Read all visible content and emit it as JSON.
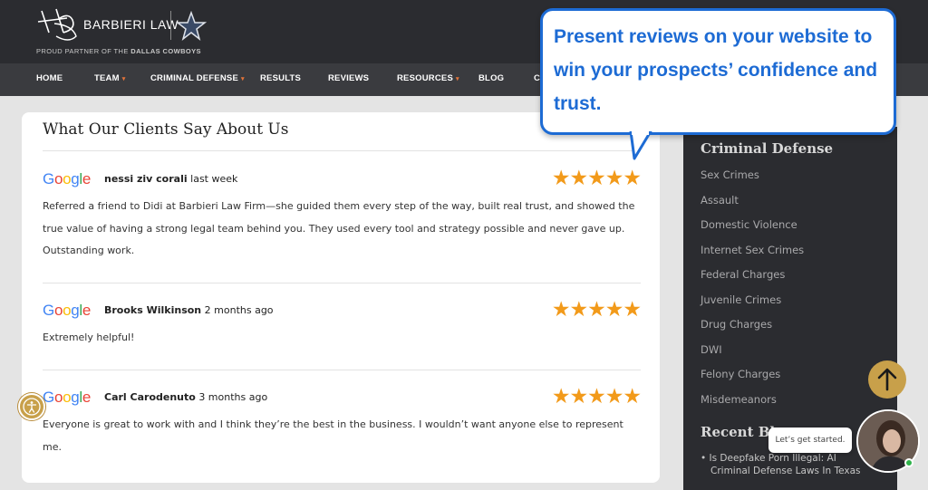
{
  "header": {
    "brand_name": "BARBIERI LAW",
    "partner_text_prefix": "PROUD PARTNER OF THE ",
    "partner_text_strong": "DALLAS COWBOYS"
  },
  "nav": {
    "home": "HOME",
    "team": "TEAM",
    "criminal_defense": "CRIMINAL DEFENSE",
    "results": "RESULTS",
    "reviews": "REVIEWS",
    "resources": "RESOURCES",
    "blog": "BLOG",
    "contact_partial": "C",
    "dropdown_caret": "▾"
  },
  "reviews_card": {
    "title": "What Our Clients Say About Us",
    "stars": "★★★★★",
    "google_letters": [
      "G",
      "o",
      "o",
      "g",
      "l",
      "e"
    ],
    "items": [
      {
        "name": "nessi ziv corali",
        "time": "last week",
        "rating": 5,
        "text": "Referred a friend to Didi at Barbieri Law Firm—she guided them every step of the way, built real trust, and showed the true value of having a strong legal team behind you. They used every tool and strategy possible and never gave up. Outstanding work."
      },
      {
        "name": "Brooks Wilkinson",
        "time": "2 months ago",
        "rating": 5,
        "text": "Extremely helpful!"
      },
      {
        "name": "Carl Carodenuto",
        "time": "3 months ago",
        "rating": 5,
        "text": "Everyone is great to work with and I think they’re the best in the business. I wouldn’t want anyone else to represent me."
      }
    ]
  },
  "sidebar": {
    "heading": "Criminal Defense",
    "links": [
      "Sex Crimes",
      "Assault",
      "Domestic Violence",
      "Internet Sex Crimes",
      "Federal Charges",
      "Juvenile Crimes",
      "Drug Charges",
      "DWI",
      "Felony Charges",
      "Misdemeanors"
    ],
    "recent_heading": "Recent Blo",
    "recent_post": "• Is Deepfake Porn Illegal: AI",
    "recent_post_2": "Criminal Defense Laws In Texas"
  },
  "callout": {
    "text": "Present reviews on your website to win your prospects’ confidence and trust."
  },
  "chat": {
    "prompt": "Let’s get started."
  },
  "colors": {
    "accent_blue": "#1d6bd4",
    "star_orange": "#f29a1a",
    "nav_caret": "#e3743a",
    "gold": "#c8a04a"
  }
}
